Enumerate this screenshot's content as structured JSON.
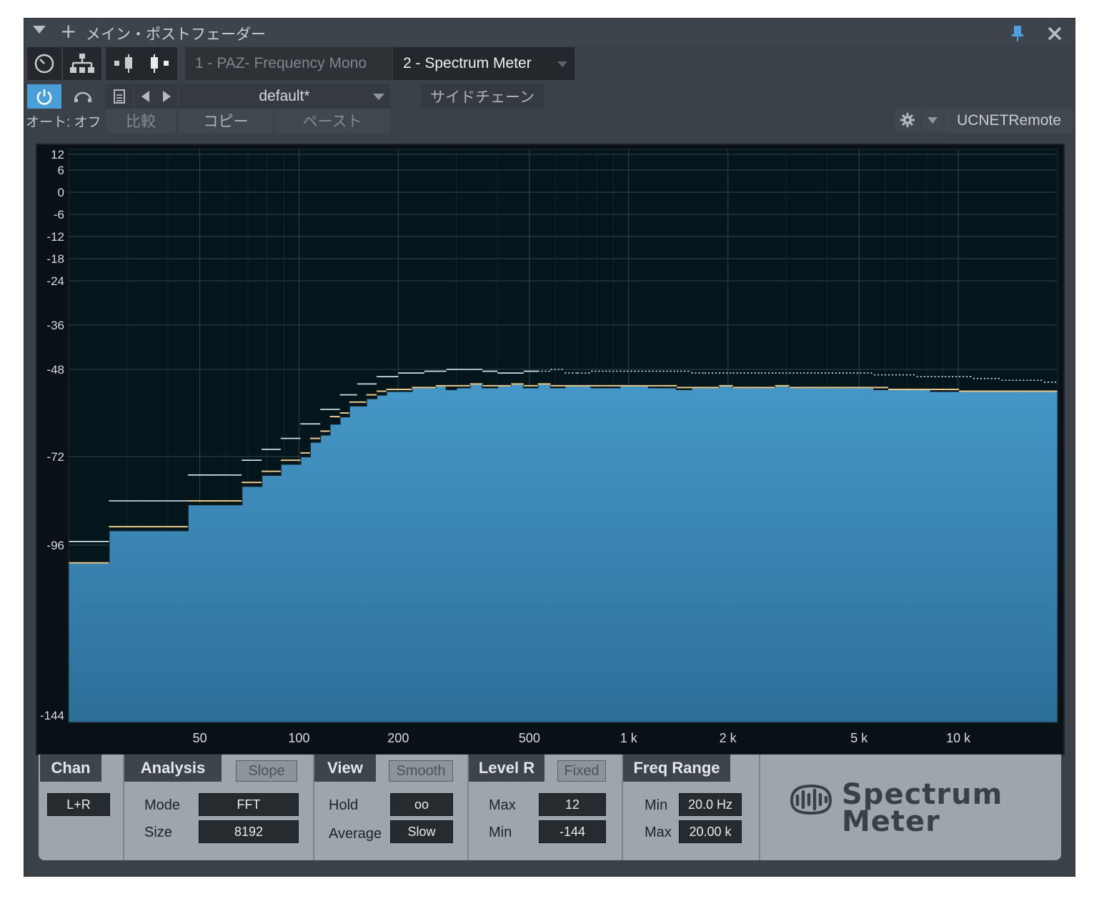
{
  "window": {
    "title": "メイン・ポストフェーダー"
  },
  "tabs": [
    {
      "label": "1 - PAZ- Frequency Mono",
      "active": false
    },
    {
      "label": "2 - Spectrum Meter",
      "active": true
    }
  ],
  "toolbar": {
    "preset": "default*",
    "sidechain": "サイドチェーン",
    "auto": "オート: オフ",
    "compare": "比較",
    "copy": "コピー",
    "paste": "ペースト",
    "remote": "UCNETRemote"
  },
  "colors": {
    "accent": "#4b9fd8",
    "spectrum_fill": "#3b8fc0",
    "peak_hold": "#dfeef7",
    "average_line": "#e9c98a",
    "plot_bg": "#04151b"
  },
  "chart_data": {
    "type": "area",
    "xscale": "log",
    "yscale": "linear",
    "xlim": [
      20,
      20000
    ],
    "ylim": [
      -144,
      12
    ],
    "x_ticks": [
      {
        "value": 50,
        "label": "50"
      },
      {
        "value": 100,
        "label": "100"
      },
      {
        "value": 200,
        "label": "200"
      },
      {
        "value": 500,
        "label": "500"
      },
      {
        "value": 1000,
        "label": "1 k"
      },
      {
        "value": 2000,
        "label": "2 k"
      },
      {
        "value": 5000,
        "label": "5 k"
      },
      {
        "value": 10000,
        "label": "10 k"
      }
    ],
    "y_ticks": [
      {
        "value": 12,
        "label": "12"
      },
      {
        "value": 6,
        "label": "6"
      },
      {
        "value": 0,
        "label": "0"
      },
      {
        "value": -6,
        "label": "-6"
      },
      {
        "value": -12,
        "label": "-12"
      },
      {
        "value": -18,
        "label": "-18"
      },
      {
        "value": -24,
        "label": "-24"
      },
      {
        "value": -36,
        "label": "-36"
      },
      {
        "value": -48,
        "label": "-48"
      },
      {
        "value": -72,
        "label": "-72"
      },
      {
        "value": -96,
        "label": "-96"
      },
      {
        "value": -144,
        "label": "-144"
      }
    ],
    "grid": true,
    "series": [
      {
        "kind": "spectrum",
        "x": [
          20,
          26.5,
          33,
          39.5,
          46,
          52,
          57,
          62,
          67,
          72,
          77,
          82,
          88,
          94,
          101,
          108,
          116,
          124,
          133,
          142,
          150,
          160,
          172,
          184,
          200,
          220,
          240,
          260,
          280,
          300,
          330,
          360,
          400,
          440,
          480,
          530,
          580,
          640,
          700,
          770,
          850,
          940,
          1040,
          1150,
          1270,
          1400,
          1550,
          1700,
          1880,
          2070,
          2290,
          2520,
          2780,
          3070,
          3390,
          3740,
          4130,
          4560,
          5030,
          5550,
          6130,
          6770,
          7470,
          8250,
          9100,
          10050,
          11100,
          12250,
          13520,
          14930,
          16480,
          18200
        ],
        "values": [
          -101,
          -92,
          -92,
          -92,
          -85,
          -85,
          -85,
          -85,
          -80,
          -80,
          -77,
          -77,
          -74,
          -74,
          -72,
          -68,
          -66,
          -63,
          -61,
          -58,
          -58,
          -56,
          -55,
          -54,
          -54,
          -53,
          -53,
          -52.5,
          -53.5,
          -53,
          -52,
          -53,
          -52.5,
          -52,
          -53,
          -52,
          -53,
          -52.5,
          -52.5,
          -53,
          -53,
          -52.5,
          -52.5,
          -53,
          -53,
          -53.5,
          -53,
          -53,
          -52.5,
          -53,
          -53,
          -53,
          -52.5,
          -53,
          -53,
          -53,
          -53,
          -53,
          -53,
          -53.5,
          -53.5,
          -53.5,
          -53.5,
          -54,
          -54,
          -54,
          -54,
          -54,
          -54,
          -54,
          -54,
          -54
        ]
      },
      {
        "kind": "peak_hold",
        "x": [
          20,
          26.5,
          33,
          39.5,
          46,
          52,
          57,
          62,
          67,
          72,
          77,
          82,
          88,
          94,
          101,
          108,
          116,
          124,
          133,
          142,
          150,
          160,
          172,
          184,
          200,
          220,
          240,
          260,
          280,
          300,
          330,
          360,
          400,
          440,
          480,
          530,
          580,
          640,
          700,
          770,
          850,
          940,
          1040,
          1150,
          1270,
          1400,
          1550,
          1700,
          1880,
          2070,
          2290,
          2520,
          2780,
          3070,
          3390,
          3740,
          4130,
          4560,
          5030,
          5550,
          6130,
          6770,
          7470,
          8250,
          9100,
          10050,
          11100,
          12250,
          13520,
          14930,
          16480,
          18200
        ],
        "values": [
          -95,
          -84,
          -84,
          -84,
          -77,
          -77,
          -77,
          -77,
          -73,
          -73,
          -70,
          -70,
          -67,
          -67,
          -63,
          -63,
          -59,
          -59,
          -55,
          -55,
          -52,
          -52,
          -50,
          -50,
          -49,
          -49,
          -48.5,
          -48.5,
          -48,
          -48,
          -48,
          -48.5,
          -49,
          -49,
          -48.5,
          -48.5,
          -48,
          -49,
          -49,
          -48.5,
          -48.5,
          -48.5,
          -48.5,
          -48.5,
          -48.5,
          -48.5,
          -49,
          -49,
          -49,
          -49,
          -49,
          -49,
          -49,
          -49,
          -49,
          -49,
          -49,
          -49,
          -49,
          -49.5,
          -49.5,
          -49.5,
          -50,
          -50,
          -50,
          -50,
          -50.5,
          -50.5,
          -51,
          -51,
          -51,
          -51.5
        ]
      },
      {
        "kind": "average",
        "x": [
          20,
          26.5,
          33,
          39.5,
          46,
          52,
          57,
          62,
          67,
          72,
          77,
          82,
          88,
          94,
          101,
          108,
          116,
          124,
          133,
          142,
          150,
          160,
          172,
          184,
          200,
          220,
          240,
          260,
          280,
          300,
          330,
          360,
          400,
          440,
          480,
          530,
          580,
          640,
          700,
          770,
          850,
          940,
          1040,
          1150,
          1270,
          1400,
          1550,
          1700,
          1880,
          2070,
          2290,
          2520,
          2780,
          3070,
          3390,
          3740,
          4130,
          4560,
          5030,
          5550,
          6130,
          6770,
          7470,
          8250,
          9100,
          10050,
          11100,
          12250,
          13520,
          14930,
          16480,
          18200
        ],
        "values": [
          -101,
          -91,
          -91,
          -91,
          -84,
          -84,
          -84,
          -84,
          -79,
          -79,
          -76,
          -76,
          -73,
          -73,
          -71,
          -67,
          -65,
          -61,
          -60,
          -57,
          -57,
          -55,
          -54,
          -53.5,
          -53.5,
          -53,
          -53,
          -52.5,
          -52.5,
          -52.5,
          -52,
          -52.5,
          -52.5,
          -52,
          -52.5,
          -52,
          -52.5,
          -52.5,
          -52.5,
          -52.5,
          -52.5,
          -52.5,
          -52.5,
          -52.5,
          -52.5,
          -53,
          -53,
          -53,
          -52.5,
          -53,
          -53,
          -53,
          -52.5,
          -53,
          -53,
          -53,
          -53,
          -53,
          -53,
          -53,
          -53.5,
          -53.5,
          -53.5,
          -53.5,
          -53.5,
          -54,
          -54,
          -54,
          -54,
          -54,
          -54,
          -54
        ]
      }
    ]
  },
  "controls": {
    "chan": {
      "title": "Chan",
      "button": "L+R"
    },
    "analysis": {
      "title": "Analysis",
      "toggle": "Slope",
      "mode_label": "Mode",
      "mode_value": "FFT",
      "size_label": "Size",
      "size_value": "8192"
    },
    "view": {
      "title": "View",
      "toggle": "Smooth",
      "hold_label": "Hold",
      "hold_value": "oo",
      "average_label": "Average",
      "average_value": "Slow"
    },
    "level": {
      "title": "Level R",
      "toggle": "Fixed",
      "max_label": "Max",
      "max_value": "12",
      "min_label": "Min",
      "min_value": "-144"
    },
    "freq": {
      "title": "Freq Range",
      "min_label": "Min",
      "min_value": "20.0 Hz",
      "max_label": "Max",
      "max_value": "20.00 k"
    }
  },
  "brand": {
    "line1": "Spectrum",
    "line2": "Meter"
  }
}
